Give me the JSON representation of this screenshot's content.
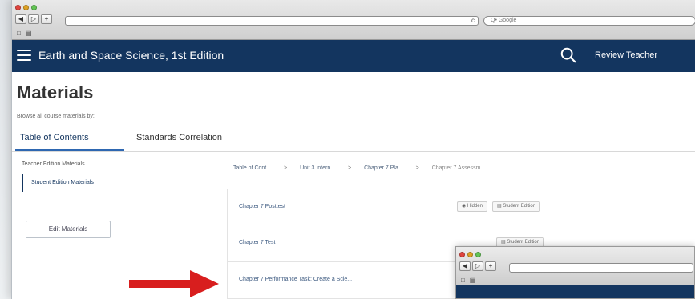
{
  "browser": {
    "search_placeholder": "Q• Google",
    "reload_glyph": "c",
    "back_glyph": "◀",
    "forward_glyph": "▷",
    "add_glyph": "+",
    "bookmark_icons": [
      "□",
      "▤"
    ]
  },
  "app": {
    "title": "Earth and Space Science, 1st Edition",
    "user": "Review Teacher",
    "header_color": "#13355f"
  },
  "page": {
    "title": "Materials",
    "browse_label": "Browse all course materials by:",
    "tabs": [
      "Table of Contents",
      "Standards Correlation"
    ],
    "active_tab": "Table of Contents"
  },
  "sidebar": {
    "items": [
      "Teacher Edition Materials",
      "Student Edition Materials"
    ],
    "active_item": "Student Edition Materials",
    "edit_button": "Edit Materials"
  },
  "breadcrumb": {
    "items": [
      "Table of Cont...",
      "Unit 3 Intern...",
      "Chapter 7 Pla...",
      "Chapter 7 Assessm..."
    ],
    "separator": ">"
  },
  "materials": [
    {
      "title": "Chapter 7 Posttest",
      "hidden_badge": "Hidden",
      "edition_badge": "Student Edition"
    },
    {
      "title": "Chapter 7 Test",
      "edition_badge": "Student Edition"
    },
    {
      "title": "Chapter 7 Performance Task: Create a Scie..."
    }
  ],
  "accent_colors": {
    "arrow": "#d81e1e",
    "tab_underline": "#2e67b1"
  }
}
